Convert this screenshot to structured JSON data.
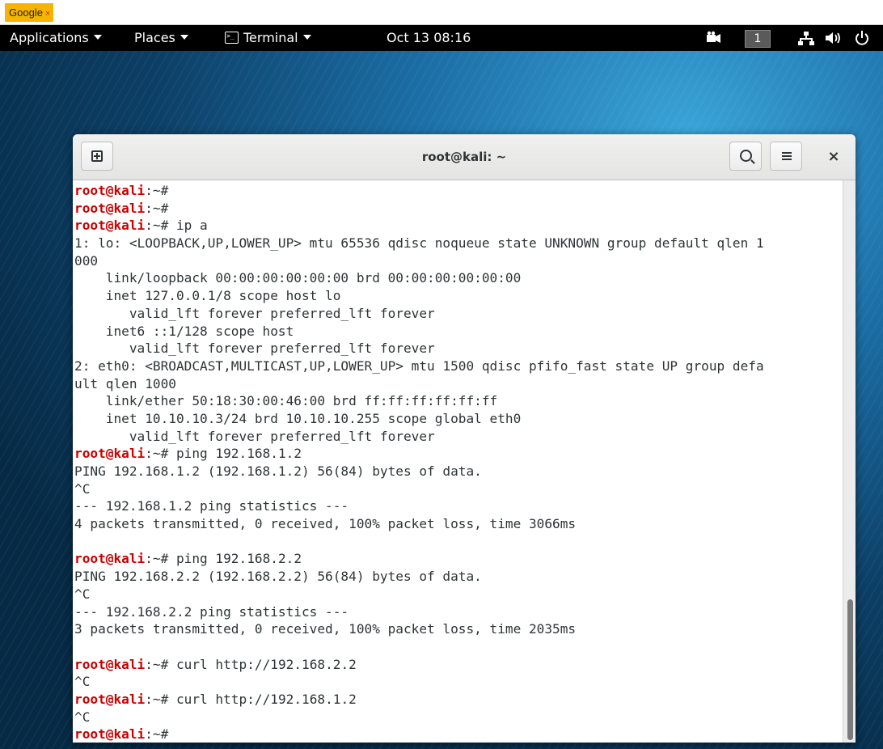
{
  "browser_tab": {
    "label": "Google",
    "close": "×"
  },
  "topbar": {
    "applications": "Applications",
    "places": "Places",
    "terminal": "Terminal",
    "clock": "Oct 13  08:16",
    "workspace": "1",
    "icons": [
      "video-camera-icon",
      "network-icon",
      "volume-icon",
      "power-icon"
    ]
  },
  "window": {
    "title": "root@kali: ~",
    "close": "×",
    "icons": [
      "new-tab-icon",
      "search-icon",
      "hamburger-menu-icon"
    ]
  },
  "prompt": {
    "user": "root@kali",
    "path": ":~#"
  },
  "terminal_lines": [
    {
      "prompt": true,
      "cmd": ""
    },
    {
      "prompt": true,
      "cmd": ""
    },
    {
      "prompt": true,
      "cmd": " ip a"
    },
    {
      "text": "1: lo: <LOOPBACK,UP,LOWER_UP> mtu 65536 qdisc noqueue state UNKNOWN group default qlen 1"
    },
    {
      "text": "000"
    },
    {
      "text": "    link/loopback 00:00:00:00:00:00 brd 00:00:00:00:00:00"
    },
    {
      "text": "    inet 127.0.0.1/8 scope host lo"
    },
    {
      "text": "       valid_lft forever preferred_lft forever"
    },
    {
      "text": "    inet6 ::1/128 scope host"
    },
    {
      "text": "       valid_lft forever preferred_lft forever"
    },
    {
      "text": "2: eth0: <BROADCAST,MULTICAST,UP,LOWER_UP> mtu 1500 qdisc pfifo_fast state UP group defa"
    },
    {
      "text": "ult qlen 1000"
    },
    {
      "text": "    link/ether 50:18:30:00:46:00 brd ff:ff:ff:ff:ff:ff"
    },
    {
      "text": "    inet 10.10.10.3/24 brd 10.10.10.255 scope global eth0"
    },
    {
      "text": "       valid_lft forever preferred_lft forever"
    },
    {
      "prompt": true,
      "cmd": " ping 192.168.1.2"
    },
    {
      "text": "PING 192.168.1.2 (192.168.1.2) 56(84) bytes of data."
    },
    {
      "text": "^C"
    },
    {
      "text": "--- 192.168.1.2 ping statistics ---"
    },
    {
      "text": "4 packets transmitted, 0 received, 100% packet loss, time 3066ms"
    },
    {
      "text": ""
    },
    {
      "prompt": true,
      "cmd": " ping 192.168.2.2"
    },
    {
      "text": "PING 192.168.2.2 (192.168.2.2) 56(84) bytes of data."
    },
    {
      "text": "^C"
    },
    {
      "text": "--- 192.168.2.2 ping statistics ---"
    },
    {
      "text": "3 packets transmitted, 0 received, 100% packet loss, time 2035ms"
    },
    {
      "text": ""
    },
    {
      "prompt": true,
      "cmd": " curl http://192.168.2.2"
    },
    {
      "text": "^C"
    },
    {
      "prompt": true,
      "cmd": " curl http://192.168.1.2"
    },
    {
      "text": "^C"
    },
    {
      "prompt": true,
      "cmd": ""
    }
  ]
}
